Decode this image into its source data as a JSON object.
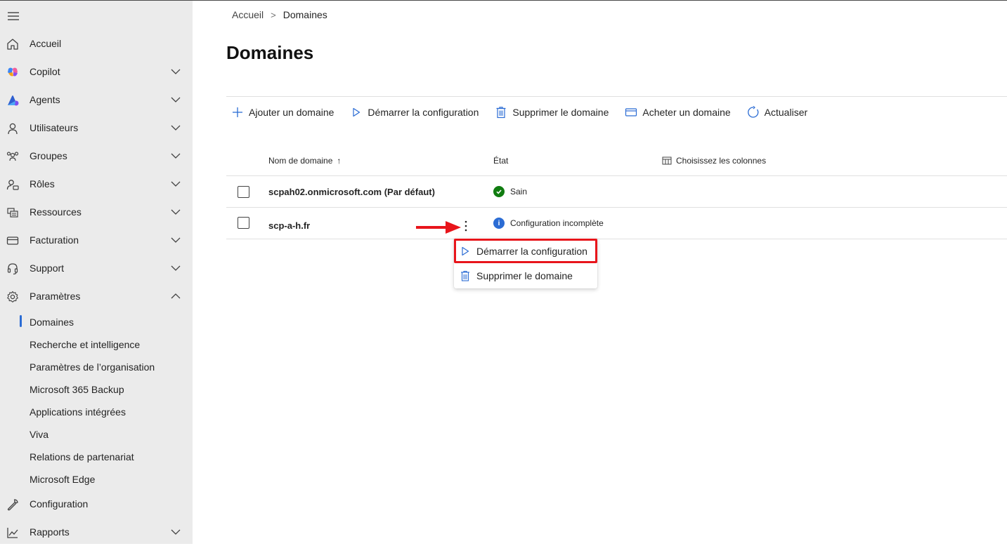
{
  "colors": {
    "sidebar_bg": "#ebebeb",
    "accent": "#2b6cd4",
    "status_ok": "#107c10",
    "status_info": "#2b6cd4",
    "annotation_red": "#e8151b"
  },
  "sidebar": {
    "items": [
      {
        "label": "Accueil",
        "icon": "home-icon"
      },
      {
        "label": "Copilot",
        "icon": "copilot-icon"
      },
      {
        "label": "Agents",
        "icon": "agents-icon"
      },
      {
        "label": "Utilisateurs",
        "icon": "person-icon"
      },
      {
        "label": "Groupes",
        "icon": "group-icon"
      },
      {
        "label": "Rôles",
        "icon": "role-icon"
      },
      {
        "label": "Ressources",
        "icon": "resources-icon"
      },
      {
        "label": "Facturation",
        "icon": "billing-icon"
      },
      {
        "label": "Support",
        "icon": "headset-icon"
      },
      {
        "label": "Paramètres",
        "icon": "gear-icon"
      }
    ],
    "settings_sub": [
      {
        "label": "Domaines",
        "active": true
      },
      {
        "label": "Recherche et intelligence"
      },
      {
        "label": "Paramètres de l’organisation"
      },
      {
        "label": "Microsoft 365 Backup"
      },
      {
        "label": "Applications intégrées"
      },
      {
        "label": "Viva"
      },
      {
        "label": "Relations de partenariat"
      },
      {
        "label": "Microsoft Edge"
      }
    ],
    "bottom_items": [
      {
        "label": "Configuration",
        "icon": "wrench-icon"
      },
      {
        "label": "Rapports",
        "icon": "chart-icon"
      }
    ]
  },
  "breadcrumb": {
    "home": "Accueil",
    "current": "Domaines"
  },
  "page_title": "Domaines",
  "toolbar": {
    "add": "Ajouter un domaine",
    "start": "Démarrer la configuration",
    "delete": "Supprimer le domaine",
    "buy": "Acheter un domaine",
    "refresh": "Actualiser"
  },
  "table": {
    "col_name": "Nom de domaine",
    "col_name_sort": "↑",
    "col_state": "État",
    "choose_columns": "Choisissez les colonnes",
    "rows": [
      {
        "name": "scpah02.onmicrosoft.com (Par défaut)",
        "state": "Sain",
        "state_type": "ok"
      },
      {
        "name": "scp-a-h.fr",
        "state": "Configuration incomplète",
        "state_type": "info"
      }
    ]
  },
  "context_menu": {
    "start": "Démarrer la configuration",
    "delete": "Supprimer le domaine"
  }
}
